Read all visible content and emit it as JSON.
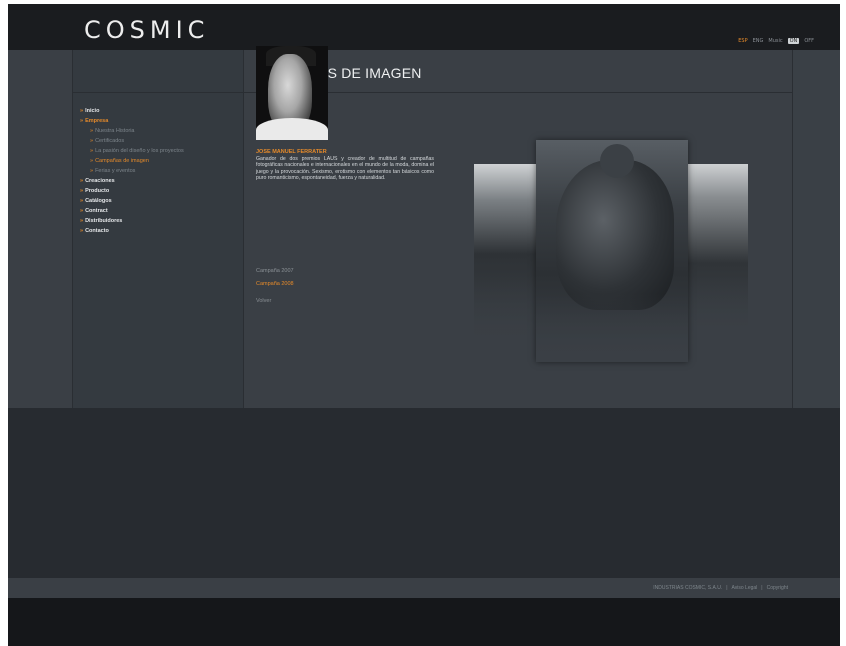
{
  "header": {
    "logo": "COSMIC",
    "languages": [
      {
        "label": "ESP",
        "active": true
      },
      {
        "label": "ENG",
        "active": false
      },
      {
        "label": "Music",
        "active": false
      },
      {
        "label": "ON",
        "active": false
      },
      {
        "label": "OFF",
        "active": false
      }
    ]
  },
  "main": {
    "title": "CAMPAÑAS DE IMAGEN"
  },
  "nav": {
    "items": [
      {
        "label": "Inicio",
        "level": 0,
        "active": false
      },
      {
        "label": "Empresa",
        "level": 0,
        "active": true
      },
      {
        "label": "Nuestra Historia",
        "level": 1,
        "active": false
      },
      {
        "label": "Certificados",
        "level": 1,
        "active": false
      },
      {
        "label": "La pasión del diseño y los proyectos",
        "level": 1,
        "active": false
      },
      {
        "label": "Campañas de imagen",
        "level": 1,
        "active": true
      },
      {
        "label": "Ferias y eventos",
        "level": 1,
        "active": false
      },
      {
        "label": "Creaciones",
        "level": 0,
        "active": false
      },
      {
        "label": "Producto",
        "level": 0,
        "active": false
      },
      {
        "label": "Catálogos",
        "level": 0,
        "active": false
      },
      {
        "label": "Contract",
        "level": 0,
        "active": false
      },
      {
        "label": "Distribuidores",
        "level": 0,
        "active": false
      },
      {
        "label": "Contacto",
        "level": 0,
        "active": false
      }
    ]
  },
  "content": {
    "person_name": "JOSE MANUEL FERRATER",
    "person_bio": "Ganador de dos premios LAUS y creador de multitud de campañas fotográficas nacionales e internacionales en el mundo de la moda, domina el juego y la provocación. Sexismo, erotismo con elementos tan básicos como puro romanticismo, espontaneidad, fuerza y naturalidad.",
    "links": {
      "campaign_2007": "Campaña 2007",
      "campaign_2008": "Campaña 2008",
      "back": "Volver"
    }
  },
  "footer": {
    "company": "INDUSTRIAS COSMIC, S.A.U.",
    "separator": "|",
    "legal": "Aviso Legal",
    "copyright": "Copyright"
  }
}
